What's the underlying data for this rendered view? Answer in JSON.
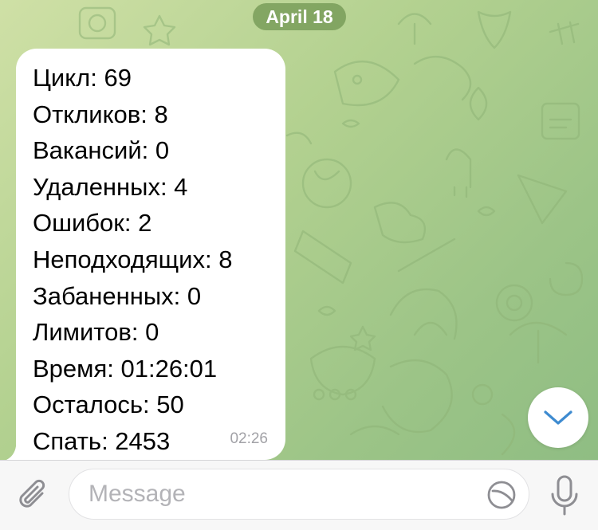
{
  "chat": {
    "date_label": "April 18"
  },
  "message": {
    "lines": [
      "Цикл: 69",
      "Откликов: 8",
      "Вакансий: 0",
      "Удаленных: 4",
      "Ошибок: 2",
      "Неподходящих: 8",
      "Забаненных: 0",
      "Лимитов: 0",
      "Время: 01:26:01",
      "Осталось: 50",
      "Спать: 2453"
    ],
    "time": "02:26"
  },
  "composer": {
    "placeholder": "Message"
  },
  "icons": {
    "attach": "paperclip-icon",
    "sticker": "sticker-icon",
    "mic": "microphone-icon",
    "scroll": "chevron-down-icon"
  },
  "colors": {
    "accent": "#3e8bd0",
    "icon_gray": "#8e8e93"
  }
}
